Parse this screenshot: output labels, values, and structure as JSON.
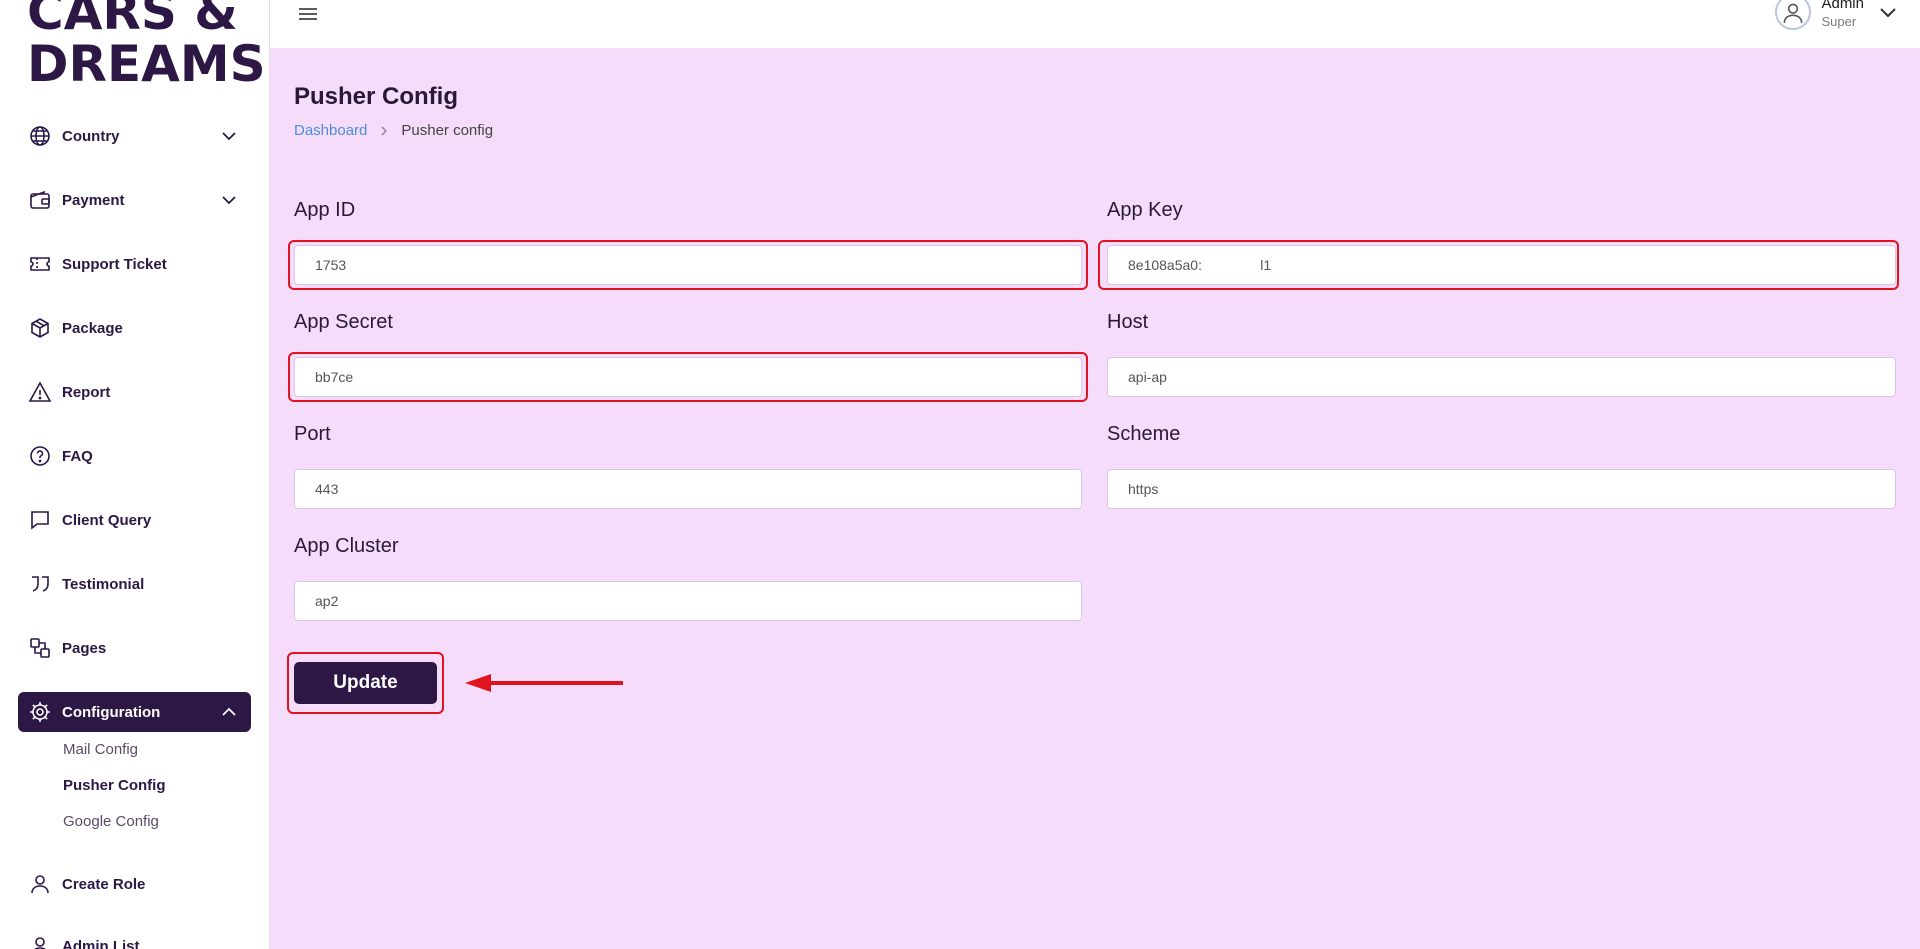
{
  "brand": {
    "line1": "CARS &",
    "line2": "DREAMS"
  },
  "sidebar": {
    "items": [
      {
        "label": "Country",
        "icon": "globe-icon",
        "expandable": true
      },
      {
        "label": "Payment",
        "icon": "wallet-icon",
        "expandable": true
      },
      {
        "label": "Support Ticket",
        "icon": "ticket-icon"
      },
      {
        "label": "Package",
        "icon": "package-icon"
      },
      {
        "label": "Report",
        "icon": "warning-icon"
      },
      {
        "label": "FAQ",
        "icon": "question-icon"
      },
      {
        "label": "Client Query",
        "icon": "chat-icon"
      },
      {
        "label": "Testimonial",
        "icon": "quote-icon"
      },
      {
        "label": "Pages",
        "icon": "pages-icon"
      },
      {
        "label": "Configuration",
        "icon": "gear-icon",
        "active": true,
        "expanded": true
      },
      {
        "label": "Create Role",
        "icon": "user-icon"
      },
      {
        "label": "Admin List",
        "icon": "user-icon"
      }
    ],
    "sub_items": [
      {
        "label": "Mail Config"
      },
      {
        "label": "Pusher Config",
        "current": true
      },
      {
        "label": "Google Config"
      }
    ],
    "active_color": "#2c1745"
  },
  "topbar": {
    "user_name": "Admin",
    "user_role": "Super"
  },
  "page": {
    "title": "Pusher Config",
    "breadcrumb": {
      "home": "Dashboard",
      "current": "Pusher config"
    }
  },
  "form": {
    "app_id": {
      "label": "App ID",
      "value": "1753"
    },
    "app_key": {
      "label": "App Key",
      "value": "8e108a5a0:               l1"
    },
    "app_secret": {
      "label": "App Secret",
      "value": "bb7ce"
    },
    "host": {
      "label": "Host",
      "value": "api-ap"
    },
    "port": {
      "label": "Port",
      "value": "443"
    },
    "scheme": {
      "label": "Scheme",
      "value": "https"
    },
    "app_cluster": {
      "label": "App Cluster",
      "value": "ap2"
    },
    "submit_label": "Update"
  },
  "colors": {
    "background": "#f5dcfb",
    "annotation": "#e0141f",
    "link": "#4d8ed8"
  }
}
